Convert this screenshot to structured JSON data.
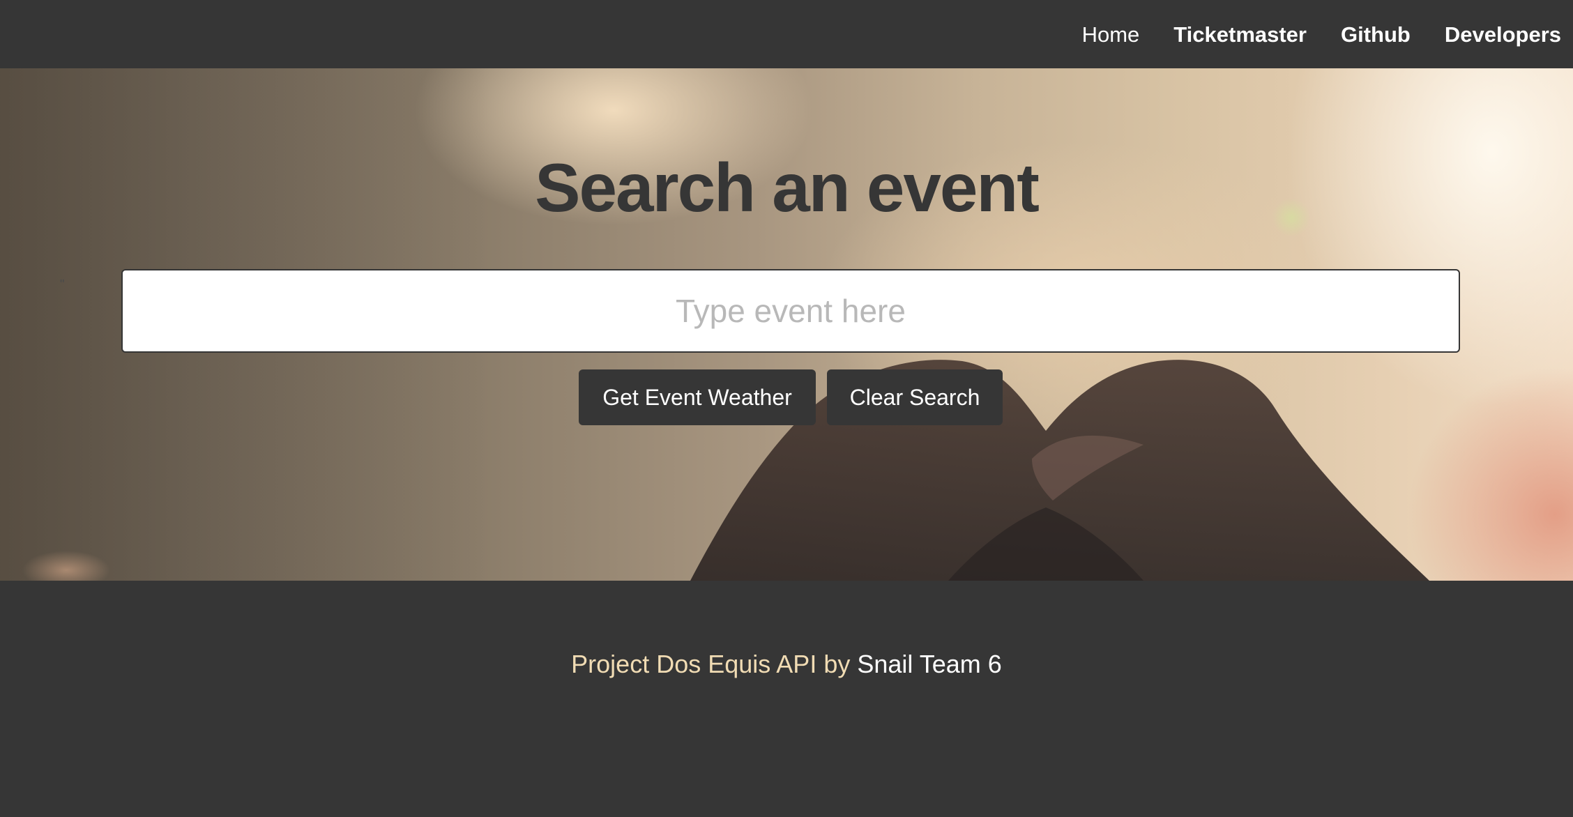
{
  "nav": {
    "items": [
      {
        "label": "Home"
      },
      {
        "label": "Ticketmaster"
      },
      {
        "label": "Github"
      },
      {
        "label": "Developers"
      }
    ]
  },
  "hero": {
    "headline": "Search an event",
    "stray_mark": "\"",
    "search": {
      "value": "",
      "placeholder": "Type event here"
    },
    "buttons": {
      "weather_label": "Get Event Weather",
      "clear_label": "Clear Search"
    }
  },
  "footer": {
    "project_text": "Project Dos Equis API by",
    "team_text": "Snail Team 6"
  },
  "colors": {
    "dark": "#363636",
    "footer_accent": "#f1dcb4",
    "white": "#ffffff"
  }
}
